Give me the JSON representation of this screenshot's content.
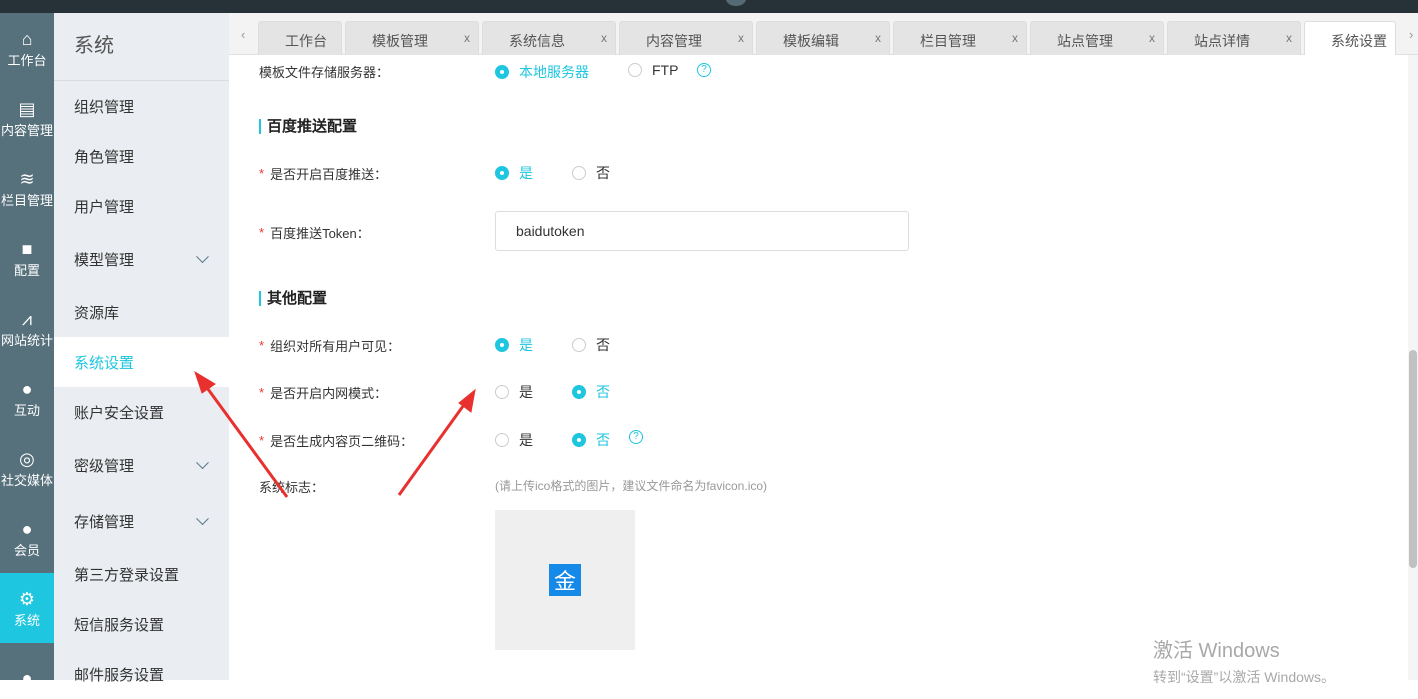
{
  "iconbar": [
    {
      "icon": "home-icon",
      "glyph": "⌂",
      "label": "工作台"
    },
    {
      "icon": "document-icon",
      "glyph": "▤",
      "label": "内容管理"
    },
    {
      "icon": "layers-icon",
      "glyph": "≋",
      "label": "栏目管理"
    },
    {
      "icon": "box-icon",
      "glyph": "■",
      "label": "配置"
    },
    {
      "icon": "chart-icon",
      "glyph": "⩘",
      "label": "网站统计"
    },
    {
      "icon": "chat-icon",
      "glyph": "●",
      "label": "互动"
    },
    {
      "icon": "social-icon",
      "glyph": "◎",
      "label": "社交媒体"
    },
    {
      "icon": "member-icon",
      "glyph": "●",
      "label": "会员"
    },
    {
      "icon": "gear-icon",
      "glyph": "⚙",
      "label": "系统"
    },
    {
      "icon": "support-icon",
      "glyph": "●",
      "label": ""
    }
  ],
  "submenu": {
    "title": "系统",
    "items": [
      {
        "label": "组织管理"
      },
      {
        "label": "角色管理"
      },
      {
        "label": "用户管理"
      },
      {
        "label": "模型管理",
        "chevron": true
      },
      {
        "label": "资源库"
      },
      {
        "label": "系统设置",
        "active": true
      },
      {
        "label": "账户安全设置"
      },
      {
        "label": "密级管理",
        "chevron": true
      },
      {
        "label": "存储管理",
        "chevron": true
      },
      {
        "label": "第三方登录设置"
      },
      {
        "label": "短信服务设置"
      },
      {
        "label": "邮件服务设置"
      }
    ]
  },
  "tabs": [
    {
      "label": "工作台"
    },
    {
      "label": "模板管理",
      "close": "x"
    },
    {
      "label": "系统信息",
      "close": "x"
    },
    {
      "label": "内容管理",
      "close": "x"
    },
    {
      "label": "模板编辑",
      "close": "x"
    },
    {
      "label": "栏目管理",
      "close": "x"
    },
    {
      "label": "站点管理",
      "close": "x"
    },
    {
      "label": "站点详情",
      "close": "x"
    },
    {
      "label": "系统设置"
    }
  ],
  "form": {
    "template_storage": {
      "label": "模板文件存储服务器：",
      "opt1": "本地服务器",
      "opt2": "FTP"
    },
    "baidu_section": "百度推送配置",
    "baidu_push": {
      "label": "是否开启百度推送：",
      "yes": "是",
      "no": "否"
    },
    "baidu_token": {
      "label": "百度推送Token：",
      "value": "baidutoken"
    },
    "other_section": "其他配置",
    "org_visible": {
      "label": "组织对所有用户可见：",
      "yes": "是",
      "no": "否"
    },
    "intranet": {
      "label": "是否开启内网模式：",
      "yes": "是",
      "no": "否"
    },
    "qrcode": {
      "label": "是否生成内容页二维码：",
      "yes": "是",
      "no": "否"
    },
    "favicon": {
      "label": "系统标志：",
      "hint": "(请上传ico格式的图片，建议文件命名为favicon.ico)",
      "glyph": "金"
    }
  },
  "watermark": {
    "line1": "激活 Windows",
    "line2": "转到“设置”以激活 Windows。"
  },
  "colors": {
    "accent": "#1ec6e0",
    "iconbar": "#56707c",
    "arrow": "#e8312e"
  }
}
